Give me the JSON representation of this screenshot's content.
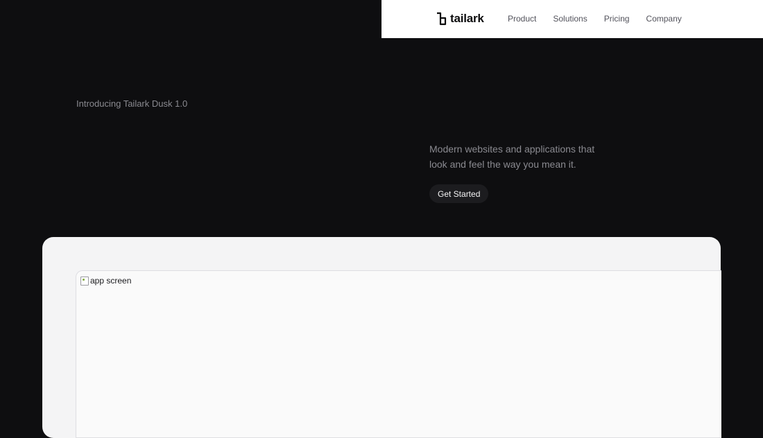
{
  "header": {
    "logo_text": "tailark",
    "logo_icon": "tailark-logo-icon",
    "nav": [
      "Product",
      "Solutions",
      "Pricing",
      "Company"
    ]
  },
  "hero": {
    "intro": "Introducing Tailark Dusk 1.0",
    "headline": "",
    "subtitle": "Modern websites and applications that look and feel the way you mean it.",
    "cta_label": "Get Started"
  },
  "showcase": {
    "image_alt": "app screen"
  },
  "colors": {
    "background": "#0e0e10",
    "navbar": "#ffffff",
    "cta": "#1c1c1f",
    "showcase": "#f4f4f5"
  }
}
